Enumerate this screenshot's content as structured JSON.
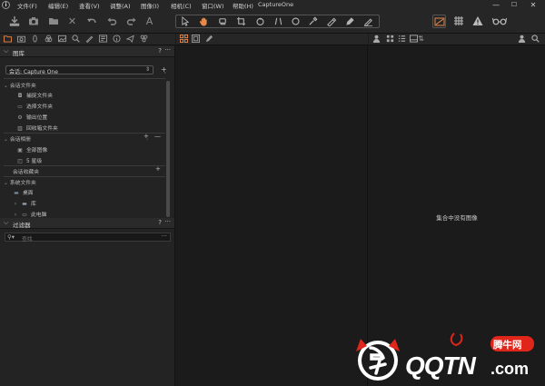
{
  "app": {
    "title": "CaptureOne",
    "logo_glyph": "i"
  },
  "menu": [
    {
      "label": "文件(F)"
    },
    {
      "label": "编辑(E)"
    },
    {
      "label": "查看(V)"
    },
    {
      "label": "调整(A)"
    },
    {
      "label": "图像(I)"
    },
    {
      "label": "相机(C)"
    },
    {
      "label": "窗口(W)"
    },
    {
      "label": "帮助(H)"
    }
  ],
  "window_controls": {
    "minimize": "—",
    "maximize": "☐",
    "close": "✕"
  },
  "toolbar": {
    "left_icons": [
      "import-icon",
      "capture-icon",
      "open-folder-icon",
      "delete-icon",
      "undo-all-icon",
      "undo-icon",
      "redo-icon",
      "text-tool-icon"
    ],
    "cursor_tools": [
      "select-cursor-icon",
      "pan-hand-icon",
      "loupe-icon",
      "crop-icon",
      "rotate-icon",
      "keystone-icon",
      "spot-removal-icon",
      "color-picker-icon",
      "draw-mask-icon",
      "erase-mask-icon",
      "annotate-icon"
    ],
    "right_icons": [
      "exposure-warning-icon",
      "grid-icon",
      "warning-icon",
      "proof-glasses-icon"
    ],
    "accent": "#e8894a"
  },
  "library": {
    "header": "图库",
    "help": "?",
    "more": "···",
    "session_label": "会话: Capture One",
    "session_folders_title": "会话文件夹",
    "session_folders": [
      {
        "label": "捕捉文件夹",
        "icon": "camera-folder-icon"
      },
      {
        "label": "选择文件夹",
        "icon": "selects-folder-icon"
      },
      {
        "label": "输出位置",
        "icon": "output-location-icon"
      },
      {
        "label": "回收箱文件夹",
        "icon": "trash-folder-icon"
      }
    ],
    "session_albums_title": "会话相册",
    "session_albums": [
      {
        "label": "全部图像",
        "icon": "all-images-icon"
      },
      {
        "label": "5 星级",
        "icon": "five-stars-icon"
      }
    ],
    "session_favorites_title": "会话收藏夹",
    "system_folders_title": "系统文件夹",
    "system_folders": [
      {
        "label": "桌面",
        "icon": "desktop-folder-icon"
      },
      {
        "label": "库",
        "icon": "library-folder-icon"
      },
      {
        "label": "此电脑",
        "icon": "computer-icon"
      }
    ]
  },
  "filters": {
    "header": "过滤器",
    "help": "?",
    "more": "···",
    "search_placeholder": "查找",
    "search_more": "···"
  },
  "viewer": {
    "empty_message": "集合中没有图像"
  },
  "watermark": {
    "brand": "腾牛网",
    "text": "QQTN",
    "suffix": ".com"
  }
}
